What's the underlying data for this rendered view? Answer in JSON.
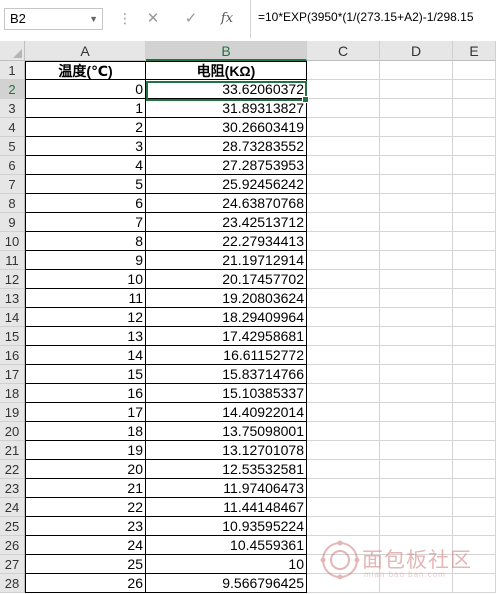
{
  "formula_bar": {
    "name_box": "B2",
    "cancel_symbol": "✕",
    "enter_symbol": "✓",
    "fx_label": "fx",
    "formula": "=10*EXP(3950*(1/(273.15+A2)-1/298.15"
  },
  "columns": [
    "A",
    "B",
    "C",
    "D",
    "E"
  ],
  "rows": [
    "1",
    "2",
    "3",
    "4",
    "5",
    "6",
    "7",
    "8",
    "9",
    "10",
    "11",
    "12",
    "13",
    "14",
    "15",
    "16",
    "17",
    "18",
    "19",
    "20",
    "21",
    "22",
    "23",
    "24",
    "25",
    "26",
    "27",
    "28"
  ],
  "table": {
    "header_a": "温度(℃)",
    "header_b": "电阻(KΩ)",
    "data": [
      [
        "0",
        "33.62060372"
      ],
      [
        "1",
        "31.89313827"
      ],
      [
        "2",
        "30.26603419"
      ],
      [
        "3",
        "28.73283552"
      ],
      [
        "4",
        "27.28753953"
      ],
      [
        "5",
        "25.92456242"
      ],
      [
        "6",
        "24.63870768"
      ],
      [
        "7",
        "23.42513712"
      ],
      [
        "8",
        "22.27934413"
      ],
      [
        "9",
        "21.19712914"
      ],
      [
        "10",
        "20.17457702"
      ],
      [
        "11",
        "19.20803624"
      ],
      [
        "12",
        "18.29409964"
      ],
      [
        "13",
        "17.42958681"
      ],
      [
        "14",
        "16.61152772"
      ],
      [
        "15",
        "15.83714766"
      ],
      [
        "16",
        "15.10385337"
      ],
      [
        "17",
        "14.40922014"
      ],
      [
        "18",
        "13.75098001"
      ],
      [
        "19",
        "13.12701078"
      ],
      [
        "20",
        "12.53532581"
      ],
      [
        "21",
        "11.97406473"
      ],
      [
        "22",
        "11.44148467"
      ],
      [
        "23",
        "10.93595224"
      ],
      [
        "24",
        "10.4559361"
      ],
      [
        "25",
        "10"
      ],
      [
        "26",
        "9.566796425"
      ]
    ]
  },
  "watermark": {
    "text": "面包板社区",
    "sub": "mian bao ban.com"
  },
  "colors": {
    "accent": "#217346",
    "header_bg": "#e6e6e6",
    "gridline": "#d4d4d4"
  }
}
